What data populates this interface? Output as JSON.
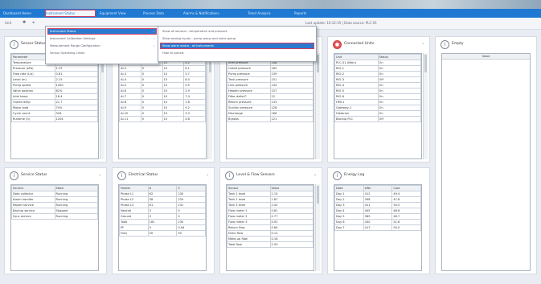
{
  "menubar": {
    "items": [
      "Dashboard Home",
      "Instrument Status",
      "Equipment View",
      "Process Data",
      "Alarms & Notifications",
      "Trend Analysis",
      "Reports"
    ],
    "active_index": 1
  },
  "toolbar": {
    "left_text": "Unit",
    "right_text": "Last update: 10:12:35 | Data source: PLC-01"
  },
  "submenu": {
    "items": [
      {
        "label": "Instrument Status",
        "has_arrow": true
      },
      {
        "label": "Instrument Calibration Settings",
        "has_arrow": true
      },
      {
        "label": "Measurement Range Configuration",
        "has_arrow": true
      },
      {
        "label": "Sensor Operating Limits",
        "has_arrow": false
      }
    ],
    "selected_index": 0
  },
  "flyout": {
    "items": [
      "Show all sensors - temperature and pressure",
      "Show analog inputs - pump group and valve group",
      "Show alarm status - all instruments",
      "Hide all panels"
    ],
    "selected_index": 2
  },
  "panels": {
    "p1": {
      "title": "Sensor Status",
      "icon": "i",
      "rows": [
        [
          "Parameter",
          "Value"
        ],
        [
          "Temperature",
          "Normal"
        ],
        [
          "Pressure (kPa)",
          "1.72"
        ],
        [
          "Flow rate (L/s)",
          "0.81"
        ],
        [
          "Level (m)",
          "2.15"
        ],
        [
          "Pump speed",
          "1450"
        ],
        [
          "Valve position",
          "62%"
        ],
        [
          "Inlet temp",
          "18.4"
        ],
        [
          "Outlet temp",
          "21.7"
        ],
        [
          "Motor load",
          "74%"
        ],
        [
          "Cycle count",
          "318"
        ],
        [
          "Runtime (h)",
          "1204"
        ]
      ]
    },
    "p2": {
      "title": "Analog Inputs",
      "icon": "i",
      "rows": [
        [
          "AI",
          "Min",
          "Max",
          "Val"
        ],
        [
          "AI-1",
          "0",
          "10",
          "4.2"
        ],
        [
          "AI-2",
          "0",
          "10",
          "6.1"
        ],
        [
          "AI-3",
          "0",
          "10",
          "3.7"
        ],
        [
          "AI-4",
          "0",
          "10",
          "8.0"
        ],
        [
          "AI-5",
          "0",
          "10",
          "5.5"
        ],
        [
          "AI-6",
          "0",
          "10",
          "2.9"
        ],
        [
          "AI-7",
          "0",
          "10",
          "7.4"
        ],
        [
          "AI-8",
          "0",
          "10",
          "1.6"
        ],
        [
          "AI-9",
          "0",
          "10",
          "9.2"
        ],
        [
          "AI-10",
          "0",
          "10",
          "3.3"
        ],
        [
          "AI-11",
          "0",
          "10",
          "4.8"
        ]
      ]
    },
    "p3": {
      "title": "Pressure Readings",
      "icon": "i",
      "rows": [
        [
          "Sensor",
          "kPa"
        ],
        [
          "Inlet pressure",
          "148"
        ],
        [
          "Outlet pressure",
          "162"
        ],
        [
          "Pump pressure",
          "139"
        ],
        [
          "Tank pressure",
          "151"
        ],
        [
          "Line pressure",
          "144"
        ],
        [
          "Header pressure",
          "157"
        ],
        [
          "Filter delta P",
          "12"
        ],
        [
          "Return pressure",
          "133"
        ],
        [
          "Suction pressure",
          "128"
        ],
        [
          "Discharge",
          "166"
        ],
        [
          "Bypass",
          "121"
        ]
      ]
    },
    "p4": {
      "title": "Connected Units",
      "icon": "●",
      "rows": [
        [
          "Unit",
          "Status"
        ],
        [
          "PLC-01 (Main)",
          "On"
        ],
        [
          "RIO-1",
          "On"
        ],
        [
          "RIO-2",
          "On"
        ],
        [
          "RIO-3",
          "Off"
        ],
        [
          "RIO-4",
          "On"
        ],
        [
          "RIO-5",
          "On"
        ],
        [
          "RIO-6",
          "On"
        ],
        [
          "HMI-1",
          "On"
        ],
        [
          "Gateway-1",
          "On"
        ],
        [
          "Historian",
          "On"
        ],
        [
          "Backup PLC",
          "Off"
        ]
      ]
    },
    "p5": {
      "title": "Empty",
      "icon": "i",
      "header": "Value"
    },
    "p6": {
      "title": "Service Status",
      "icon": "i",
      "rows": [
        [
          "Service",
          "State"
        ],
        [
          "Data collector",
          "Running"
        ],
        [
          "Alarm handler",
          "Running"
        ],
        [
          "Report service",
          "Running"
        ],
        [
          "Backup service",
          "Stopped"
        ],
        [
          "Sync service",
          "Running"
        ]
      ]
    },
    "p7": {
      "title": "Electrical Status",
      "icon": "i",
      "rows": [
        [
          "Feeder",
          "A",
          "V"
        ],
        [
          "Phase L1",
          "62",
          "230"
        ],
        [
          "Phase L2",
          "58",
          "229"
        ],
        [
          "Phase L3",
          "61",
          "231"
        ],
        [
          "Neutral",
          "3",
          "0"
        ],
        [
          "Ground",
          "0",
          "0"
        ],
        [
          "Total",
          "181",
          "230"
        ],
        [
          "PF",
          "0",
          "0.94"
        ],
        [
          "Freq",
          "50",
          "50"
        ]
      ]
    },
    "p8": {
      "title": "Level & Flow Sensors",
      "icon": "i",
      "rows": [
        [
          "Sensor",
          "Value"
        ],
        [
          "Tank 1 level",
          "2.15"
        ],
        [
          "Tank 2 level",
          "1.87"
        ],
        [
          "Tank 3 level",
          "2.42"
        ],
        [
          "Flow meter 1",
          "0.81"
        ],
        [
          "Flow meter 2",
          "0.77"
        ],
        [
          "Flow meter 3",
          "0.92"
        ],
        [
          "Return flow",
          "0.64"
        ],
        [
          "Drain flow",
          "0.12"
        ],
        [
          "Make-up flow",
          "0.18"
        ],
        [
          "Total flow",
          "2.50"
        ]
      ]
    },
    "p9": {
      "title": "Energy Log",
      "icon": "i",
      "rows": [
        [
          "Date",
          "kWh",
          "Cost"
        ],
        [
          "Day 1",
          "412",
          "49.4"
        ],
        [
          "Day 2",
          "398",
          "47.8"
        ],
        [
          "Day 3",
          "421",
          "50.5"
        ],
        [
          "Day 4",
          "405",
          "48.6"
        ],
        [
          "Day 5",
          "389",
          "46.7"
        ],
        [
          "Day 6",
          "430",
          "51.6"
        ],
        [
          "Day 7",
          "417",
          "50.0"
        ]
      ]
    }
  }
}
